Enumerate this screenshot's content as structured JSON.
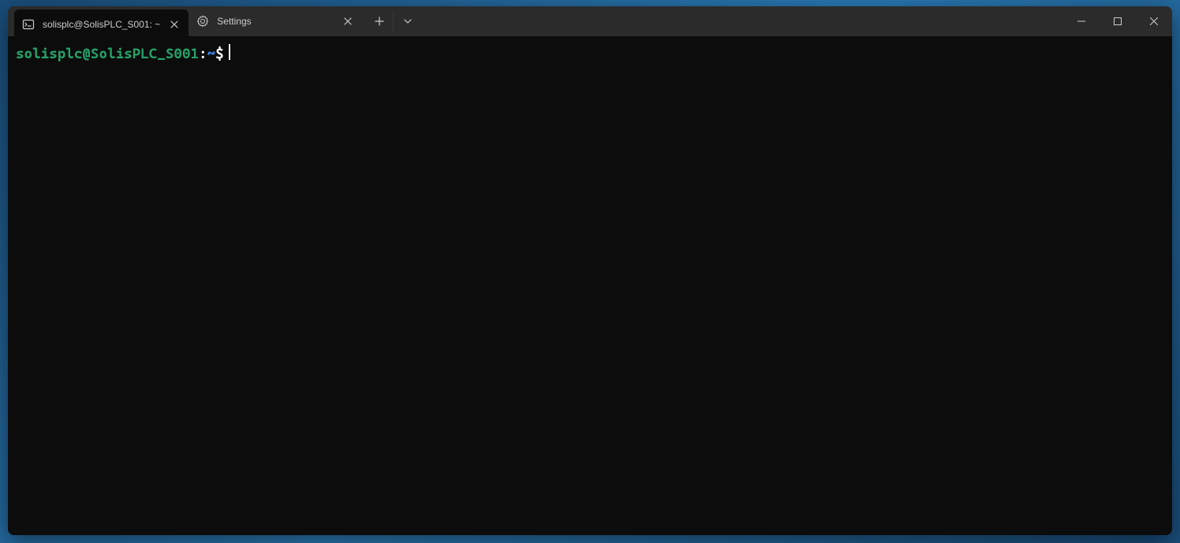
{
  "tabs": [
    {
      "title": "solisplc@SolisPLC_S001: ~",
      "icon": "terminal-icon",
      "active": true
    },
    {
      "title": "Settings",
      "icon": "gear-icon",
      "active": false
    }
  ],
  "prompt": {
    "user_host": "solisplc@SolisPLC_S001",
    "separator": ":",
    "path": "~",
    "symbol": "$"
  },
  "colors": {
    "bg": "#0c0c0c",
    "titlebar": "#2b2b2b",
    "prompt_user": "#26a269",
    "prompt_path": "#3584e4",
    "text": "#cccccc"
  }
}
